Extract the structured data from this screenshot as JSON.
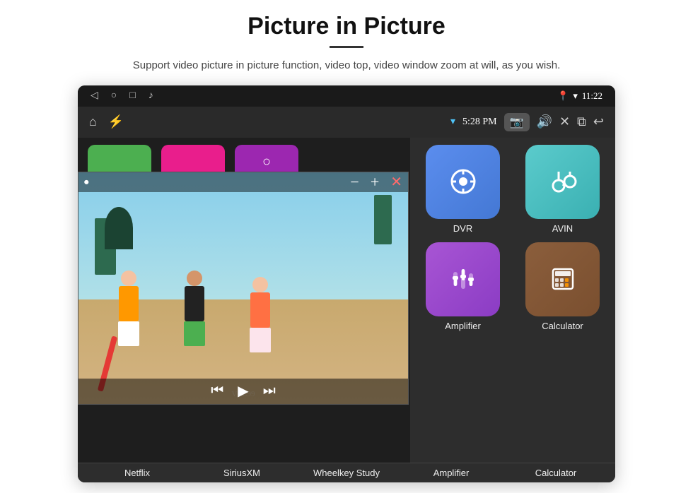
{
  "page": {
    "title": "Picture in Picture",
    "subtitle": "Support video picture in picture function, video top, video window zoom at will, as you wish."
  },
  "status_bar": {
    "time": "11:22",
    "nav_back": "◁",
    "nav_home": "○",
    "nav_recent": "□",
    "nav_music": "♪"
  },
  "app_bar": {
    "time": "5:28 PM",
    "home_icon": "⌂",
    "usb_icon": "⚡"
  },
  "pip_window": {
    "minus": "−",
    "plus": "+",
    "close": "✕"
  },
  "app_grid": [
    {
      "id": "dvr",
      "label": "DVR",
      "icon": "📡",
      "color_class": "dvr"
    },
    {
      "id": "avin",
      "label": "AVIN",
      "icon": "🎵",
      "color_class": "avin"
    },
    {
      "id": "amplifier",
      "label": "Amplifier",
      "icon": "🎚",
      "color_class": "amplifier"
    },
    {
      "id": "calculator",
      "label": "Calculator",
      "icon": "🧮",
      "color_class": "calculator"
    }
  ],
  "bottom_apps": [
    {
      "label": "Netflix"
    },
    {
      "label": "SiriusXM"
    },
    {
      "label": "Wheelkey Study"
    },
    {
      "label": "Amplifier"
    },
    {
      "label": "Calculator"
    }
  ]
}
